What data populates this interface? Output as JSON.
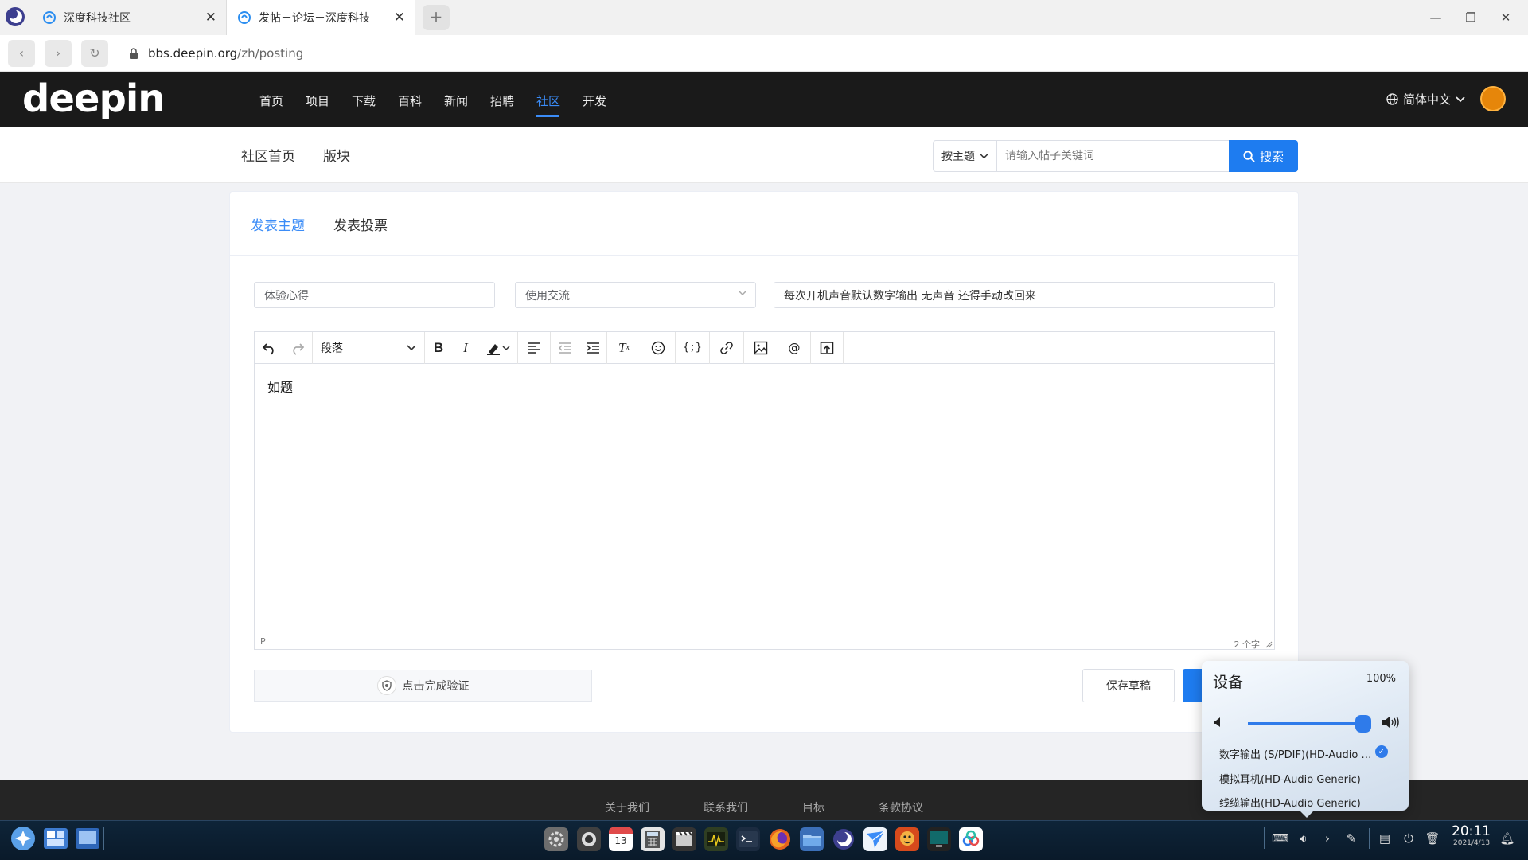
{
  "browser": {
    "tabs": [
      {
        "title": "深度科技社区"
      },
      {
        "title": "发帖－论坛－深度科技"
      }
    ],
    "url_host": "bbs.deepin.org",
    "url_path": "/zh/posting"
  },
  "site": {
    "logo": "deepin",
    "nav": [
      "首页",
      "项目",
      "下载",
      "百科",
      "新闻",
      "招聘",
      "社区",
      "开发"
    ],
    "active_nav": "社区",
    "language": "简体中文",
    "subnav": [
      "社区首页",
      "版块"
    ],
    "search": {
      "type": "按主题",
      "placeholder": "请输入帖子关键词",
      "button": "搜索"
    }
  },
  "post": {
    "tabs": [
      "发表主题",
      "发表投票"
    ],
    "active_tab": "发表主题",
    "category_placeholder": "体验心得",
    "forum_select": "使用交流",
    "title_value": "每次开机声音默认数字输出 无声音 还得手动改回来",
    "editor": {
      "paragraph_format": "段落",
      "content": "如题",
      "status_path": "P",
      "word_count": "2 个字"
    },
    "captcha": "点击完成验证",
    "save_draft": "保存草稿"
  },
  "footer": {
    "links": [
      "关于我们",
      "联系我们",
      "目标",
      "条款协议"
    ]
  },
  "sound_popup": {
    "title": "设备",
    "volume_percent": "100%",
    "volume_level": 1.0,
    "devices": [
      {
        "name": "数字输出 (S/PDIF)(HD-Audio …",
        "selected": true
      },
      {
        "name": "模拟耳机(HD-Audio Generic)",
        "selected": false
      },
      {
        "name": "线缆输出(HD-Audio Generic)",
        "selected": false
      }
    ]
  },
  "taskbar": {
    "time": "20:11",
    "date": "2021/4/13",
    "calendar_day": "13"
  },
  "colors": {
    "accent": "#1e7cf0",
    "header_bg": "#1a1a1a",
    "dock_bg": "#0e2438"
  }
}
